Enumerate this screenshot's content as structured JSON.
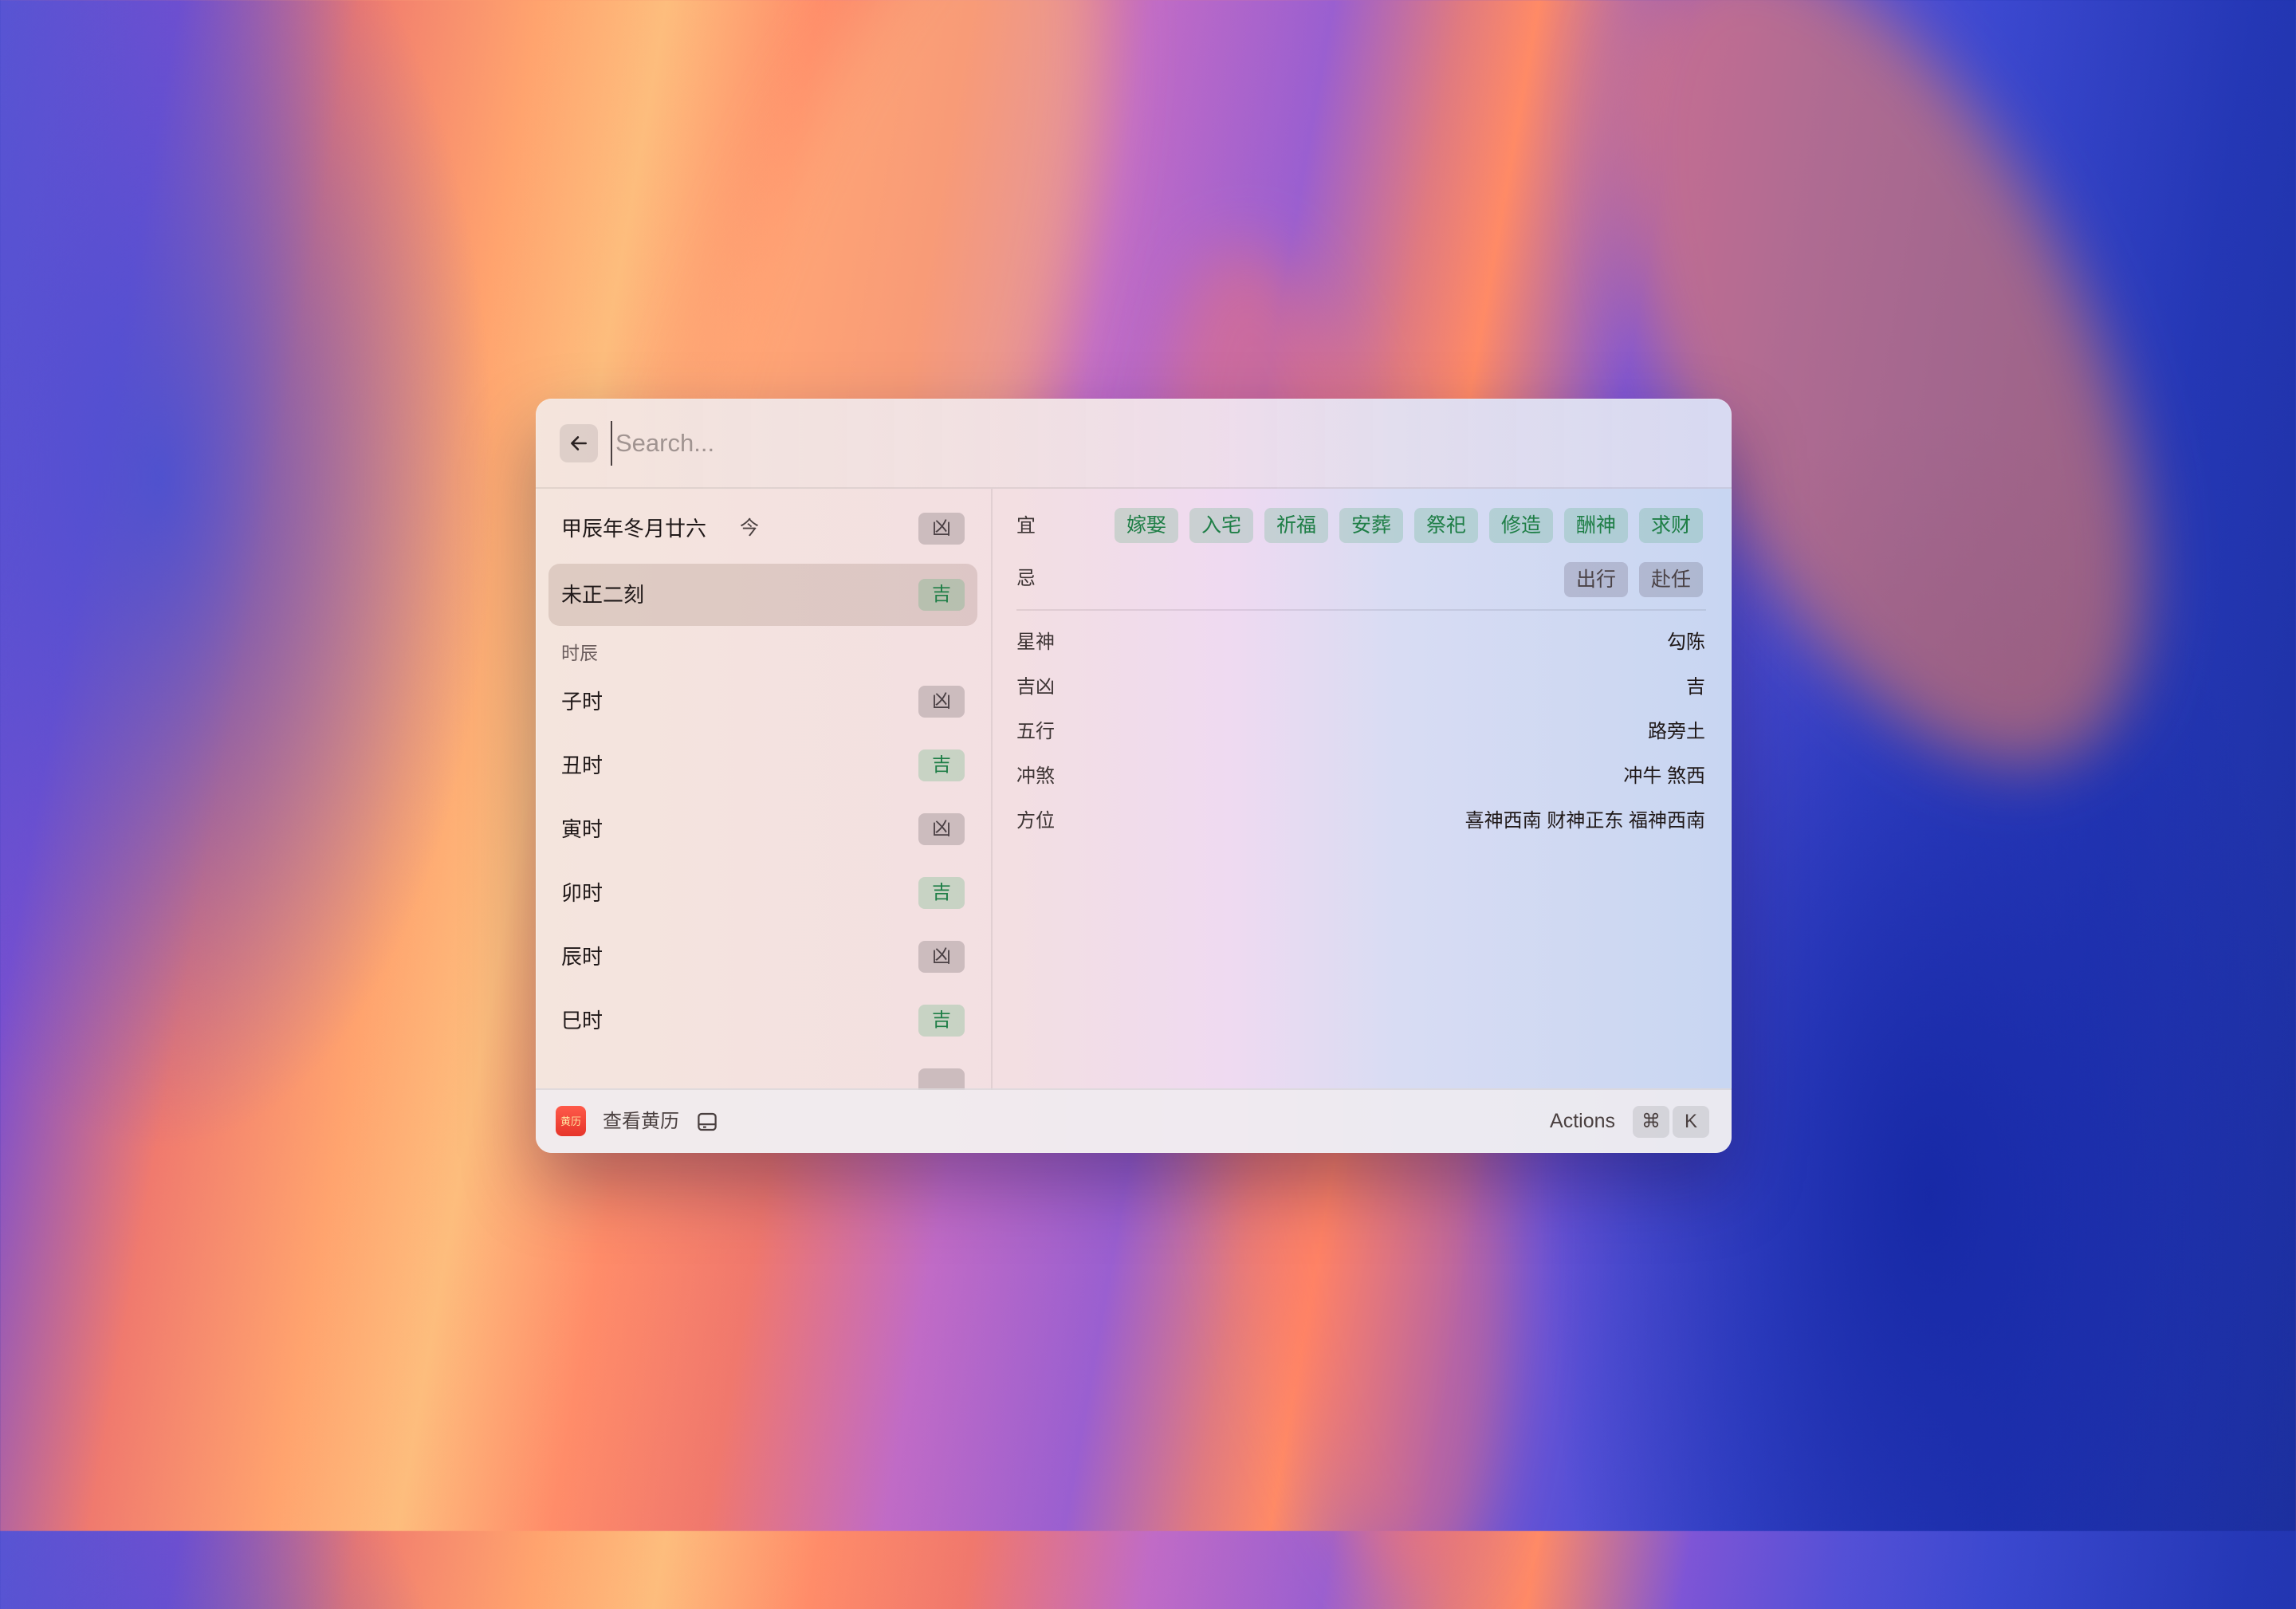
{
  "search": {
    "placeholder": "Search..."
  },
  "left": {
    "header_row": {
      "label": "甲辰年冬月廿六",
      "today": "今",
      "tag": "凶"
    },
    "selected_row": {
      "label": "未正二刻",
      "tag": "吉"
    },
    "section_label": "时辰",
    "items": [
      {
        "label": "子时",
        "tag": "凶"
      },
      {
        "label": "丑时",
        "tag": "吉"
      },
      {
        "label": "寅时",
        "tag": "凶"
      },
      {
        "label": "卯时",
        "tag": "吉"
      },
      {
        "label": "辰时",
        "tag": "凶"
      },
      {
        "label": "巳时",
        "tag": "吉"
      }
    ]
  },
  "detail": {
    "yi_label": "宜",
    "yi": [
      "嫁娶",
      "入宅",
      "祈福",
      "安葬",
      "祭祀",
      "修造",
      "酬神",
      "求财"
    ],
    "ji_label": "忌",
    "ji": [
      "出行",
      "赴任"
    ],
    "info": [
      {
        "label": "星神",
        "value": "勾陈"
      },
      {
        "label": "吉凶",
        "value": "吉"
      },
      {
        "label": "五行",
        "value": "路旁土"
      },
      {
        "label": "冲煞",
        "value": "冲牛 煞西"
      },
      {
        "label": "方位",
        "value": "喜神西南 财神正东 福神西南"
      }
    ]
  },
  "footer": {
    "app_icon_text": "黄历",
    "title": "查看黄历",
    "actions_label": "Actions",
    "kbd_cmd": "⌘",
    "kbd_k": "K"
  },
  "icons": {
    "back": "arrow-left-icon",
    "app": "calendar-app-icon",
    "panel": "sidebar-panel-icon"
  }
}
